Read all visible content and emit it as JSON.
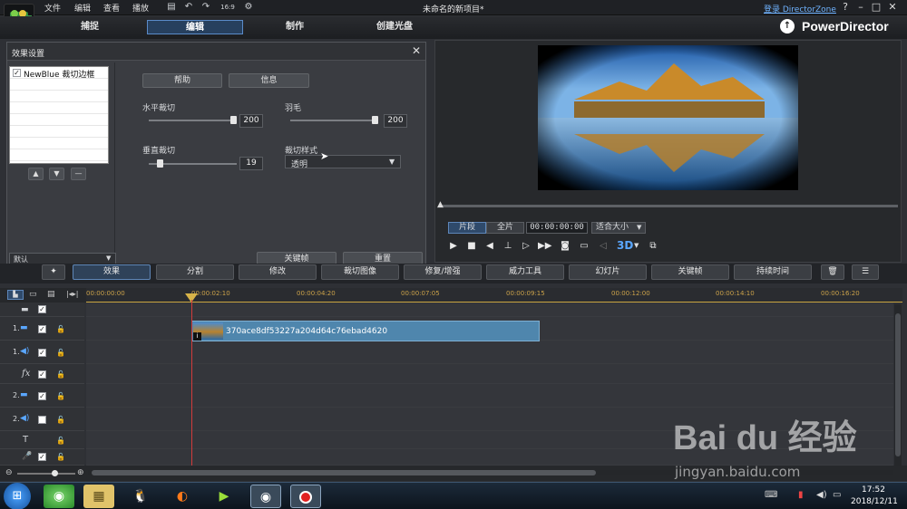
{
  "window": {
    "menu": [
      "文件",
      "编辑",
      "查看",
      "播放"
    ],
    "title": "未命名的新项目*",
    "login_link": "登录 DirectorZone",
    "help": "?",
    "zoom_label": "16:9"
  },
  "tabs": [
    {
      "label": "捕捉",
      "active": false
    },
    {
      "label": "编辑",
      "active": true
    },
    {
      "label": "制作",
      "active": false
    },
    {
      "label": "创建光盘",
      "active": false
    }
  ],
  "brand": "PowerDirector",
  "effect_panel": {
    "title": "效果设置",
    "effect_item": "NewBlue 裁切边框",
    "effect_checked": true,
    "help_button": "帮助",
    "info_button": "信息",
    "params": {
      "horizontal_label": "水平裁切",
      "horizontal_value": "200",
      "horizontal_level": 1.0,
      "feather_label": "羽毛",
      "feather_value": "200",
      "feather_level": 1.0,
      "vertical_label": "垂直裁切",
      "vertical_value": "19",
      "vertical_level": 0.095,
      "style_label": "裁切样式",
      "style_value": "透明"
    },
    "preset_partial": "默认",
    "keyframe_partial": "关键帧",
    "reset_partial": "重置"
  },
  "preview": {
    "mode_clip": "片段",
    "mode_full": "全片",
    "timecode": "00:00:00:00",
    "fit_label": "适合大小",
    "threed": "3D"
  },
  "toolbar": {
    "buttons": [
      "效果",
      "分割",
      "修改",
      "裁切图像",
      "修复/增强",
      "威力工具",
      "幻灯片",
      "关键帧",
      "持续时间"
    ]
  },
  "timeline": {
    "ticks": [
      "00:00:00:00",
      "00:00:02:10",
      "00:00:04:20",
      "00:00:07:05",
      "00:00:09:15",
      "00:00:12:00",
      "00:00:14:10",
      "00:00:16:20"
    ],
    "tracks": [
      {
        "label": "1.",
        "icon": "video-track-icon",
        "checked": true
      },
      {
        "label": "1.",
        "icon": "audio-track-icon",
        "checked": true
      },
      {
        "label": "",
        "icon": "fx-track-icon",
        "checked": true
      },
      {
        "label": "2.",
        "icon": "video-track-icon",
        "checked": true
      },
      {
        "label": "2.",
        "icon": "audio-track-icon",
        "checked": false
      },
      {
        "label": "",
        "icon": "title-track-icon",
        "checked": false
      },
      {
        "label": "",
        "icon": "voice-track-icon",
        "checked": true
      }
    ],
    "clip_name": "370ace8df53227a204d64c76ebad4620"
  },
  "taskbar": {
    "time": "17:52",
    "date": "2018/12/11"
  },
  "watermark": {
    "brand": "Bai du 经验",
    "url": "jingyan.baidu.com"
  }
}
